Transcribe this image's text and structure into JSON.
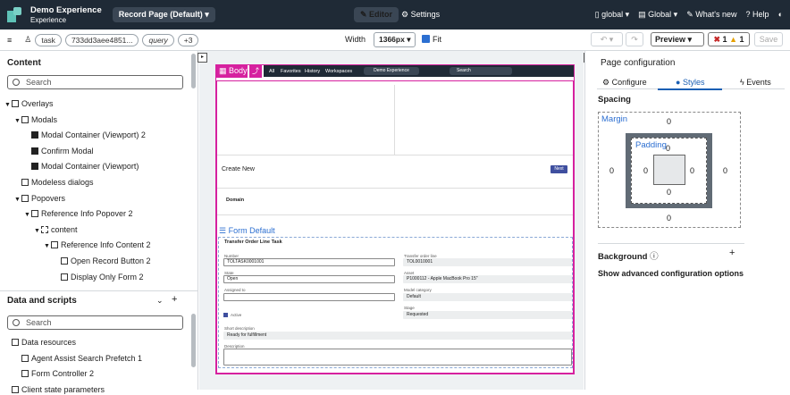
{
  "header": {
    "app_title": "Demo Experience",
    "app_subtitle": "Experience",
    "page_selector": "Record Page (Default) ▾",
    "editor_tab": "Editor",
    "settings_tab": "Settings",
    "scope": "global ▾",
    "global_menu": "Global ▾",
    "whats_new": "What's new",
    "help": "Help"
  },
  "toolbar": {
    "chips": [
      "task",
      "733dd3aee4851...",
      "query",
      "+3"
    ],
    "width_label": "Width",
    "width_value": "1366px ▾",
    "fit_label": "Fit",
    "preview_label": "Preview ▾",
    "error_count": "1",
    "warning_count": "1",
    "save_label": "Save"
  },
  "content_panel": {
    "title": "Content",
    "search_placeholder": "Search",
    "tree": [
      {
        "label": "Overlays",
        "depth": 0,
        "icon": "overlay-icon",
        "expanded": true
      },
      {
        "label": "Modals",
        "depth": 1,
        "icon": "modal-icon",
        "expanded": true
      },
      {
        "label": "Modal Container (Viewport) 2",
        "depth": 2,
        "icon": "container-icon"
      },
      {
        "label": "Confirm Modal",
        "depth": 2,
        "icon": "container-icon"
      },
      {
        "label": "Modal Container (Viewport)",
        "depth": 2,
        "icon": "container-icon"
      },
      {
        "label": "Modeless dialogs",
        "depth": 1,
        "icon": "dialog-icon"
      },
      {
        "label": "Popovers",
        "depth": 1,
        "icon": "popover-icon",
        "expanded": true
      },
      {
        "label": "Reference Info Popover 2",
        "depth": 2,
        "icon": "popover-icon",
        "expanded": true
      },
      {
        "label": "content",
        "depth": 3,
        "icon": "slot-icon",
        "expanded": true
      },
      {
        "label": "Reference Info Content 2",
        "depth": 4,
        "icon": "content-icon",
        "expanded": true
      },
      {
        "label": "Open Record Button 2",
        "depth": 5,
        "icon": "button-icon"
      },
      {
        "label": "Display Only Form 2",
        "depth": 5,
        "icon": "form-icon"
      }
    ]
  },
  "data_panel": {
    "title": "Data and scripts",
    "search_placeholder": "Search",
    "tree": [
      {
        "label": "Data resources",
        "depth": 0,
        "icon": "database-icon"
      },
      {
        "label": "Agent Assist Search Prefetch 1",
        "depth": 1,
        "icon": "database-icon"
      },
      {
        "label": "Form Controller 2",
        "depth": 1,
        "icon": "database-icon"
      },
      {
        "label": "Client state parameters",
        "depth": 0,
        "icon": "param-icon"
      }
    ]
  },
  "canvas": {
    "body_tag": "Body",
    "nav_items": [
      "All",
      "Favorites",
      "History",
      "Workspaces"
    ],
    "nav_pill": "Demo Experience",
    "nav_search": "Search",
    "create_new": "Create New",
    "next_button": "Next",
    "domain_label": "Domain",
    "form_default": "Form Default",
    "form_title": "Transfer Order Line Task",
    "fields": {
      "number_label": "Number",
      "number_value": "TOLTASK0001001",
      "transfer_line_label": "Transfer order line",
      "transfer_line_value": "TOL0010001",
      "state_label": "State",
      "state_value": "Open",
      "asset_label": "Asset",
      "asset_value": "P1000112 - Apple MacBook Pro 15\"",
      "assigned_label": "Assigned to",
      "assigned_value": "",
      "model_label": "Model category",
      "model_value": "Default",
      "active_label": "Active",
      "stage_label": "Stage",
      "stage_value": "Requested",
      "short_desc_label": "Short description",
      "short_desc_value": "Ready for fulfillment",
      "desc_label": "Description",
      "desc_value": ""
    }
  },
  "config_panel": {
    "title": "Page configuration",
    "tabs": [
      "Configure",
      "Styles",
      "Events"
    ],
    "active_tab": "Styles",
    "spacing_title": "Spacing",
    "margin_label": "Margin",
    "padding_label": "Padding",
    "margin": {
      "top": "0",
      "right": "0",
      "bottom": "0",
      "left": "0"
    },
    "padding": {
      "top": "0",
      "right": "0",
      "bottom": "0",
      "left": "0"
    },
    "background_title": "Background",
    "advanced_label": "Show advanced configuration options"
  }
}
